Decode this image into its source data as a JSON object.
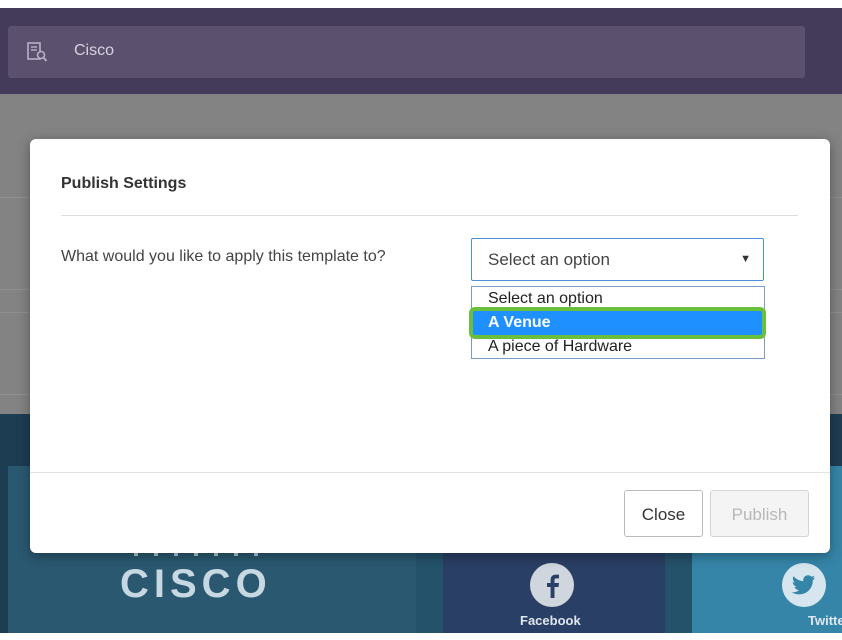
{
  "header": {
    "title": "Cisco",
    "icon": "document-search-icon"
  },
  "background": {
    "brand_text": "CISCO",
    "social": [
      {
        "label": "Facebook",
        "icon": "facebook-icon",
        "color": "#2a3f65"
      },
      {
        "label": "Twitter",
        "icon": "twitter-icon",
        "color": "#3585a8"
      }
    ]
  },
  "modal": {
    "title": "Publish Settings",
    "question": "What would you like to apply this template to?",
    "select": {
      "value": "Select an option",
      "options": [
        "Select an option",
        "A Venue",
        "A piece of Hardware"
      ],
      "highlighted_option": "A Venue"
    },
    "buttons": {
      "close_label": "Close",
      "publish_label": "Publish"
    }
  },
  "colors": {
    "accent": "#1e90ff",
    "highlight_ring": "#6abf3c",
    "header": "#443a5a"
  }
}
